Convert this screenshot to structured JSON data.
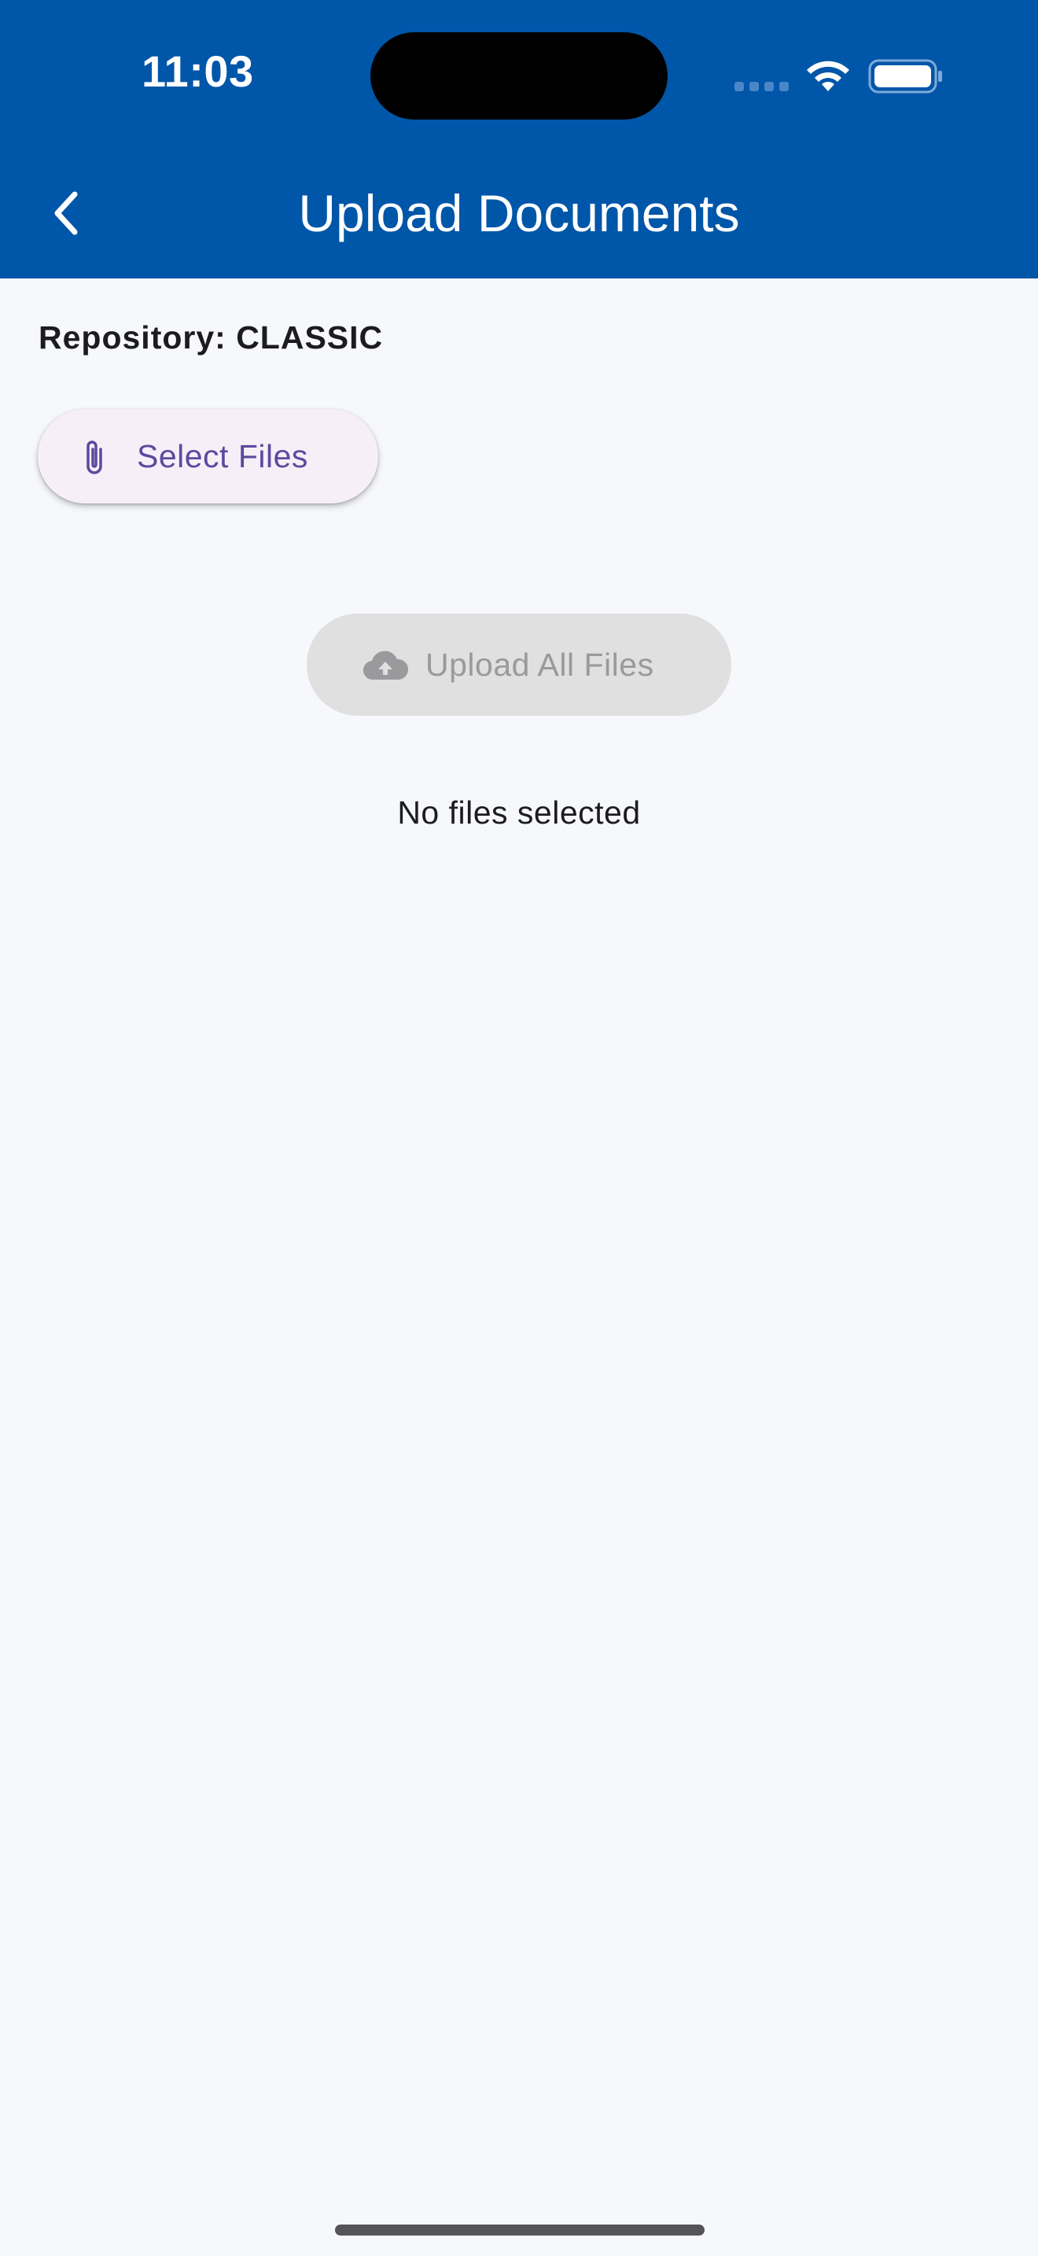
{
  "status_bar": {
    "time": "11:03"
  },
  "header": {
    "title": "Upload Documents",
    "background_color": "#0056a8",
    "back_icon": "chevron-left-icon"
  },
  "main": {
    "repository_label": "Repository: CLASSIC",
    "select_files_button": {
      "label": "Select Files",
      "icon": "paperclip-icon",
      "color": "#5b4a9e"
    },
    "upload_button": {
      "label": "Upload All Files",
      "icon": "cloud-upload-icon",
      "enabled": false
    },
    "empty_message": "No files selected"
  }
}
